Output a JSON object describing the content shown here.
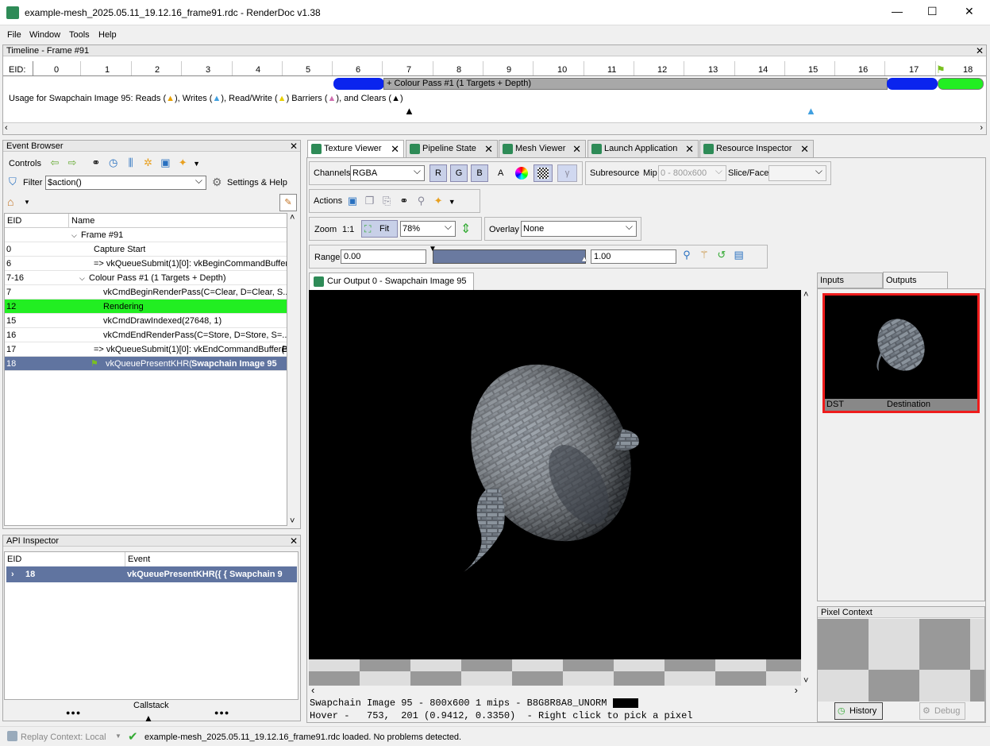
{
  "window": {
    "title": "example-mesh_2025.05.11_19.12.16_frame91.rdc - RenderDoc v1.38",
    "controls": [
      "—",
      "☐",
      "✕"
    ]
  },
  "menu": [
    "File",
    "Window",
    "Tools",
    "Help"
  ],
  "timeline": {
    "title": "Timeline - Frame #91",
    "eid_label": "EID:",
    "markers": [
      "0",
      "1",
      "2",
      "3",
      "4",
      "5",
      "6",
      "7",
      "8",
      "9",
      "10",
      "11",
      "12",
      "13",
      "14",
      "15",
      "16",
      "17",
      "18"
    ],
    "pass_label": "+ Colour Pass #1 (1 Targets + Depth)",
    "usage_text_a": "Usage for Swapchain Image 95: Reads (",
    "usage_text_b": "), Writes (",
    "usage_text_c": "), Read/Write (",
    "usage_text_d": ") Barriers (",
    "usage_text_e": "), and Clears (",
    "usage_text_f": ")"
  },
  "event_browser": {
    "title": "Event Browser",
    "controls_label": "Controls",
    "filter_label": "Filter",
    "filter_value": "$action()",
    "settings_label": "Settings & Help",
    "columns": [
      "EID",
      "Name"
    ],
    "rows": [
      {
        "eid": "",
        "name": "Frame #91"
      },
      {
        "eid": "0",
        "name": "Capture Start"
      },
      {
        "eid": "6",
        "name": "=> vkQueueSubmit(1)[0]: vkBeginCommandBuffer("
      },
      {
        "eid": "7-16",
        "name": "Colour Pass #1 (1 Targets + Depth)"
      },
      {
        "eid": "7",
        "name": "vkCmdBeginRenderPass(C=Clear, D=Clear, S..."
      },
      {
        "eid": "12",
        "name": "Rendering"
      },
      {
        "eid": "15",
        "name": "vkCmdDrawIndexed(27648, 1)"
      },
      {
        "eid": "16",
        "name": "vkCmdEndRenderPass(C=Store, D=Store, S=..."
      },
      {
        "eid": "17",
        "name": "=> vkQueueSubmit(1)[0]: vkEndCommandBuffer("
      },
      {
        "eid": "18",
        "name": "vkQueuePresentKHR("
      }
    ],
    "row17_bold": "B",
    "row18_bold": "Swapchain Image 95"
  },
  "api_inspector": {
    "title": "API Inspector",
    "columns": [
      "EID",
      "Event"
    ],
    "row_eid": "18",
    "row_event": "vkQueuePresentKHR({ { Swapchain 9",
    "dots": "●●●",
    "callstack": "Callstack"
  },
  "tabs": [
    "Texture Viewer",
    "Pipeline State",
    "Mesh Viewer",
    "Launch Application",
    "Resource Inspector"
  ],
  "texture_viewer": {
    "channels_label": "Channels",
    "channels_value": "RGBA",
    "rgba_buttons": [
      "R",
      "G",
      "B",
      "A"
    ],
    "subresource_label": "Subresource",
    "mip_label": "Mip",
    "mip_value": "0 - 800x600",
    "slice_label": "Slice/Face",
    "actions_label": "Actions",
    "zoom_label": "Zoom",
    "zoom_11": "1:1",
    "fit_label": "Fit",
    "zoom_value": "78%",
    "overlay_label": "Overlay",
    "overlay_value": "None",
    "range_label": "Range",
    "range_min": "0.00",
    "range_max": "1.00",
    "output_tab": "Cur Output 0 - Swapchain Image 95",
    "status_line1": "Swapchain Image 95 - 800x600 1 mips - B8G8R8A8_UNORM",
    "status_line2": "Hover -   753,  201 (0.9412, 0.3350)  - Right click to pick a pixel"
  },
  "thumbnails": {
    "inputs_tab": "Inputs",
    "outputs_tab": "Outputs",
    "dst_label": "DST",
    "dest_label": "Destination"
  },
  "pixel_context": {
    "title": "Pixel Context",
    "history": "History",
    "debug": "Debug"
  },
  "statusbar": {
    "replay_context": "Replay Context: Local",
    "message": "example-mesh_2025.05.11_19.12.16_frame91.rdc loaded. No problems detected."
  },
  "colors": {
    "accent_green": "#2e8b57",
    "selection_blue": "#6074a0",
    "highlight_green": "#22ee22",
    "pass_blue": "#0033ee",
    "thumb_border": "#ee1c1c"
  }
}
